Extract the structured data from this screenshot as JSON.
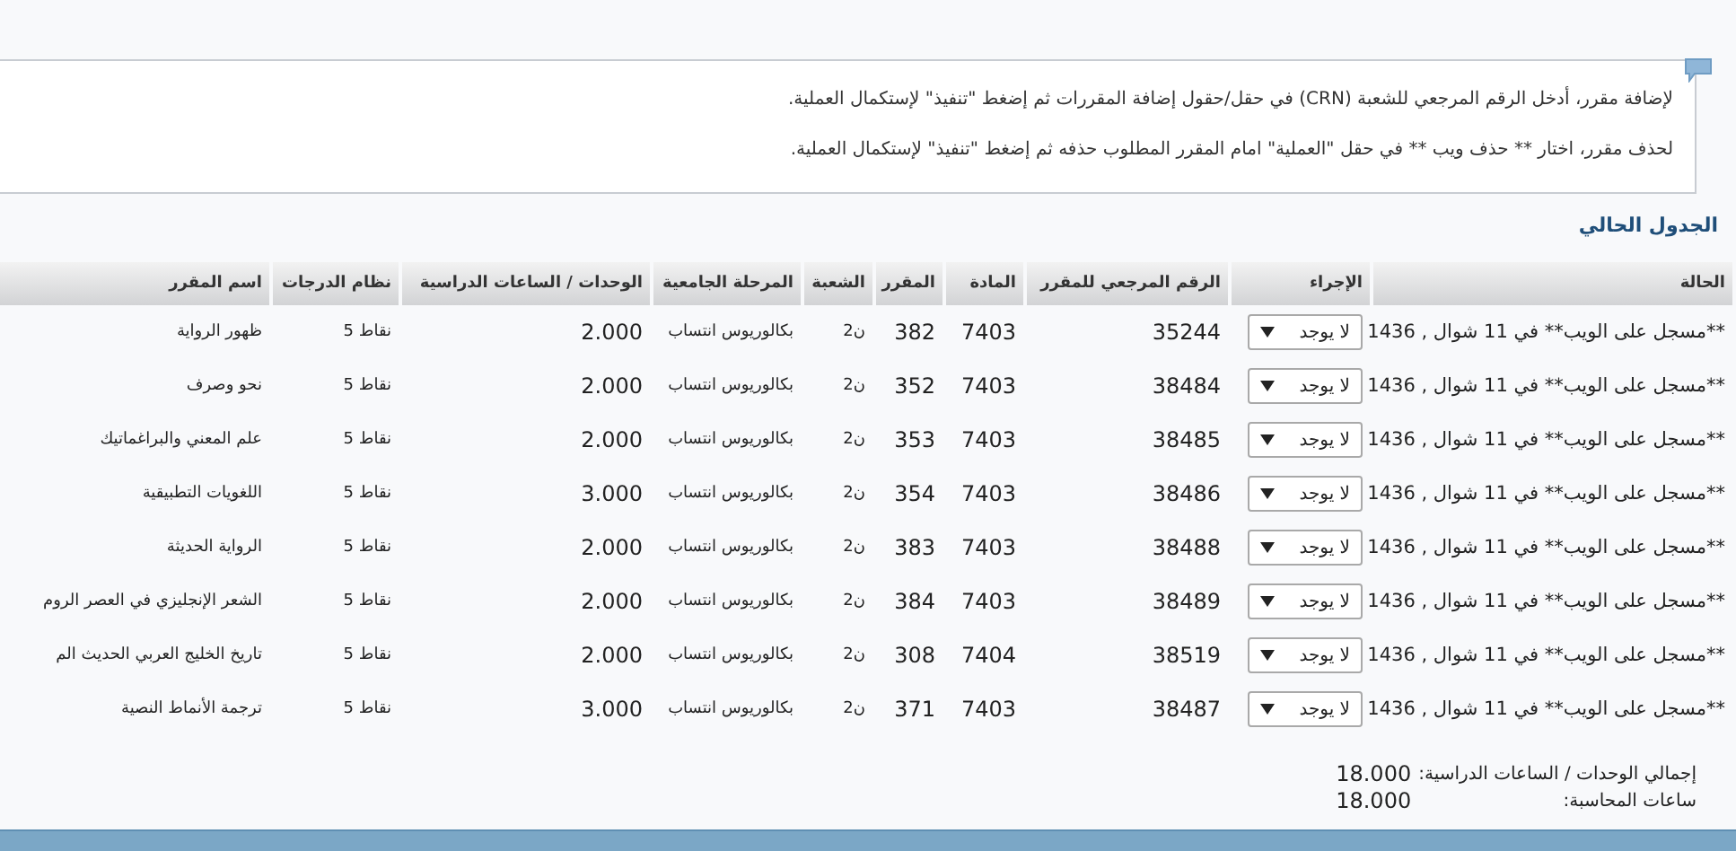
{
  "info_box": {
    "lines": [
      "لإضافة مقرر، أدخل الرقم المرجعي للشعبة (CRN) في حقل/حقول إضافة المقررات ثم إضغط \"تنفيذ\" لإستكمال العملية.",
      "لحذف مقرر، اختار ** حذف ويب ** في حقل \"العملية\" امام المقرر المطلوب حذفه ثم إضغط \"تنفيذ\" لإستكمال العملية."
    ]
  },
  "section_title": "الجدول الحالي",
  "table": {
    "columns": [
      "الحالة",
      "الإجراء",
      "الرقم المرجعي للمقرر",
      "المادة",
      "المقرر",
      "الشعبة",
      "المرحلة الجامعية",
      "الوحدات / الساعات الدراسية",
      "نظام الدرجات",
      "اسم المقرر"
    ],
    "rows": [
      {
        "status": "**مسجل على الويب** في 11 شوال , 1436",
        "action": "لا يوجد",
        "crn": "35244",
        "subject": "7403",
        "course": "382",
        "section": "ن2",
        "level": "بكالوريوس انتساب",
        "credits": "2.000",
        "grade_mode": "نقاط 5",
        "title": "ظهور الرواية"
      },
      {
        "status": "**مسجل على الويب** في 11 شوال , 1436",
        "action": "لا يوجد",
        "crn": "38484",
        "subject": "7403",
        "course": "352",
        "section": "ن2",
        "level": "بكالوريوس انتساب",
        "credits": "2.000",
        "grade_mode": "نقاط 5",
        "title": "نحو وصرف"
      },
      {
        "status": "**مسجل على الويب** في 11 شوال , 1436",
        "action": "لا يوجد",
        "crn": "38485",
        "subject": "7403",
        "course": "353",
        "section": "ن2",
        "level": "بكالوريوس انتساب",
        "credits": "2.000",
        "grade_mode": "نقاط 5",
        "title": "علم المعني والبراغماتيك"
      },
      {
        "status": "**مسجل على الويب** في 11 شوال , 1436",
        "action": "لا يوجد",
        "crn": "38486",
        "subject": "7403",
        "course": "354",
        "section": "ن2",
        "level": "بكالوريوس انتساب",
        "credits": "3.000",
        "grade_mode": "نقاط 5",
        "title": "اللغويات التطبيقية"
      },
      {
        "status": "**مسجل على الويب** في 11 شوال , 1436",
        "action": "لا يوجد",
        "crn": "38488",
        "subject": "7403",
        "course": "383",
        "section": "ن2",
        "level": "بكالوريوس انتساب",
        "credits": "2.000",
        "grade_mode": "نقاط 5",
        "title": "الرواية الحديثة"
      },
      {
        "status": "**مسجل على الويب** في 11 شوال , 1436",
        "action": "لا يوجد",
        "crn": "38489",
        "subject": "7403",
        "course": "384",
        "section": "ن2",
        "level": "بكالوريوس انتساب",
        "credits": "2.000",
        "grade_mode": "نقاط 5",
        "title": "الشعر الإنجليزي في العصر الروم"
      },
      {
        "status": "**مسجل على الويب** في 11 شوال , 1436",
        "action": "لا يوجد",
        "crn": "38519",
        "subject": "7404",
        "course": "308",
        "section": "ن2",
        "level": "بكالوريوس انتساب",
        "credits": "2.000",
        "grade_mode": "نقاط 5",
        "title": "تاريخ الخليج العربي الحديث الم"
      },
      {
        "status": "**مسجل على الويب** في 11 شوال , 1436",
        "action": "لا يوجد",
        "crn": "38487",
        "subject": "7403",
        "course": "371",
        "section": "ن2",
        "level": "بكالوريوس انتساب",
        "credits": "3.000",
        "grade_mode": "نقاط 5",
        "title": "ترجمة الأنماط النصية"
      }
    ]
  },
  "totals": [
    {
      "label": "إجمالي الوحدات / الساعات الدراسية:",
      "value": "18.000"
    },
    {
      "label": "ساعات المحاسبة:",
      "value": "18.000"
    }
  ]
}
